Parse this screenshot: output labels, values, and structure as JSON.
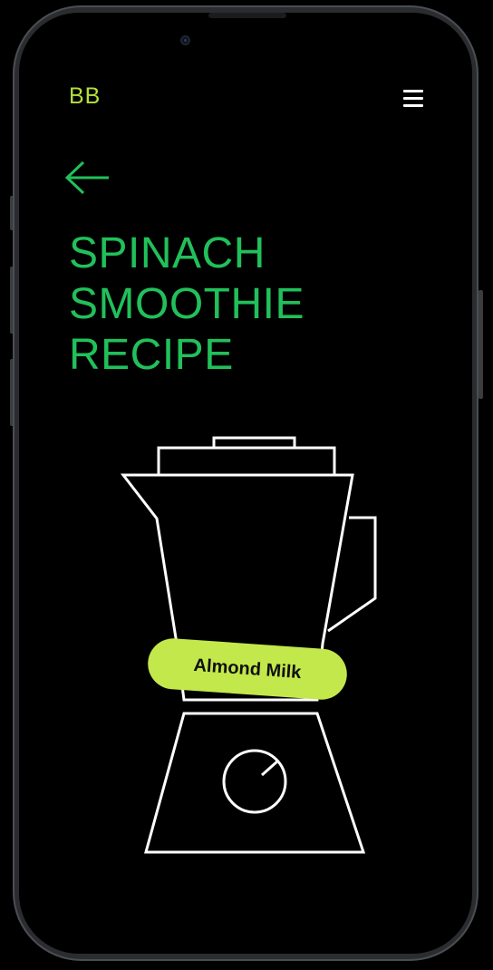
{
  "header": {
    "brand": "BB",
    "menu_icon": "hamburger-menu-icon",
    "back_icon": "arrow-left-icon"
  },
  "recipe": {
    "title_lines": [
      "SPINACH",
      "SMOOTHIE",
      "RECIPE"
    ],
    "ingredient_label": "Almond Milk"
  },
  "colors": {
    "background": "#000000",
    "brand": "#b4e03a",
    "title": "#21c05a",
    "pill": "#c3e84b",
    "line_art": "#ffffff"
  }
}
